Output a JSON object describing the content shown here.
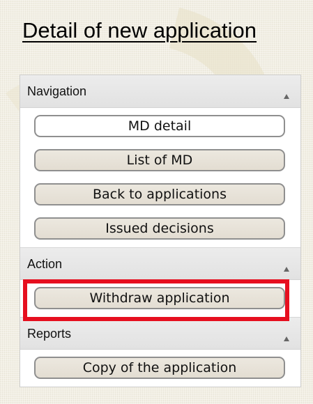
{
  "page": {
    "title": "Detail of new application"
  },
  "panel": {
    "sections": [
      {
        "header": "Navigation",
        "buttons": [
          "MD detail",
          "List of MD",
          "Back to applications",
          "Issued decisions"
        ]
      },
      {
        "header": "Action",
        "buttons": [
          "Withdraw application"
        ]
      },
      {
        "header": "Reports",
        "buttons": [
          "Copy of the application"
        ]
      }
    ]
  },
  "colors": {
    "background": "#f2efe4",
    "highlight_border": "#e60f1f",
    "button_fill": "#e6e1d7",
    "active_button_fill": "#ffffff"
  },
  "icons": {
    "section_toggle": "caret-up-icon"
  }
}
